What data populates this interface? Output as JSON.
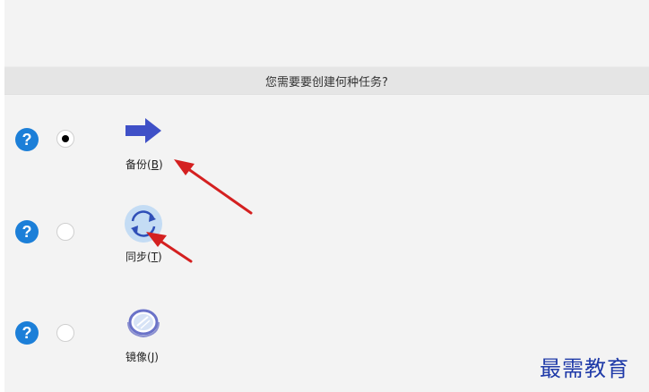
{
  "dialog": {
    "question": "您需要要创建何种任务?"
  },
  "options": [
    {
      "label": "备份",
      "shortcut": "B",
      "icon": "backup-arrow-icon",
      "selected": true
    },
    {
      "label": "同步",
      "shortcut": "T",
      "icon": "sync-icon",
      "selected": false
    },
    {
      "label": "镜像",
      "shortcut": "J",
      "icon": "mirror-icon",
      "selected": false
    }
  ],
  "help_glyph": "?",
  "watermark": "最需教育",
  "colors": {
    "help_blue": "#1c7fd8",
    "icon_blue": "#3f50c7",
    "annotation_red": "#d42020"
  }
}
